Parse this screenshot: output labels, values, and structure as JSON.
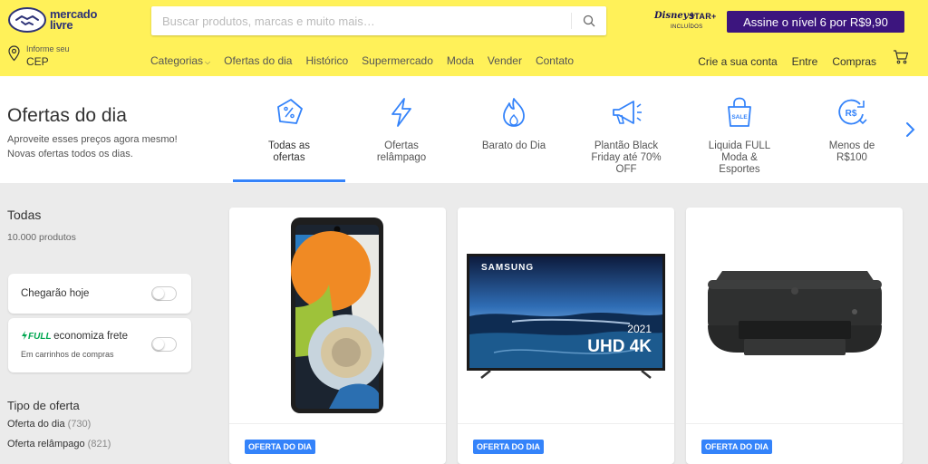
{
  "header": {
    "logo_line1": "mercado",
    "logo_line2": "livre",
    "search_placeholder": "Buscar produtos, marcas e muito mais…",
    "promo_partner_a": "Disney+",
    "promo_partner_b": "STAR+",
    "promo_partner_note": "INCLUÍDOS",
    "promo_button": "Assine o nível 6 por R$9,90",
    "location_label": "Informe seu",
    "location_value": "CEP",
    "nav": [
      "Categorias",
      "Ofertas do dia",
      "Histórico",
      "Supermercado",
      "Moda",
      "Vender",
      "Contato"
    ],
    "user_nav": [
      "Crie a sua conta",
      "Entre",
      "Compras"
    ]
  },
  "deals": {
    "title": "Ofertas do dia",
    "subtitle_1": "Aproveite esses preços agora mesmo!",
    "subtitle_2": "Novas ofertas todos os dias.",
    "categories": [
      {
        "icon": "percent-tag-icon",
        "line1": "Todas as",
        "line2": "ofertas",
        "line3": ""
      },
      {
        "icon": "lightning-icon",
        "line1": "Ofertas",
        "line2": "relâmpago",
        "line3": ""
      },
      {
        "icon": "flame-icon",
        "line1": "Barato do Dia",
        "line2": "",
        "line3": ""
      },
      {
        "icon": "megaphone-icon",
        "line1": "Plantão Black",
        "line2": "Friday até 70%",
        "line3": "OFF"
      },
      {
        "icon": "sale-bag-icon",
        "line1": "Liquida FULL",
        "line2": "Moda &",
        "line3": "Esportes"
      },
      {
        "icon": "money-down-icon",
        "line1": "Menos de",
        "line2": "R$100",
        "line3": ""
      }
    ],
    "active_index": 0
  },
  "sidebar": {
    "title": "Todas",
    "count": "10.000 produtos",
    "filter_1": "Chegarão hoje",
    "filter_2_badge": "FULL",
    "filter_2": "economiza frete",
    "filter_2_sub": "Em carrinhos de compras",
    "tipo_title": "Tipo de oferta",
    "tipo_items": [
      {
        "label": "Oferta do dia",
        "count": "(730)"
      },
      {
        "label": "Oferta relâmpago",
        "count": "(821)"
      }
    ]
  },
  "products": [
    {
      "image": "smartphone",
      "badge": "OFERTA DO DIA"
    },
    {
      "image": "samsung-tv",
      "brand": "SAMSUNG",
      "year": "2021",
      "label": "UHD 4K",
      "badge": "OFERTA DO DIA"
    },
    {
      "image": "printer",
      "badge": "OFERTA DO DIA"
    }
  ],
  "colors": {
    "header_bg": "#fff159",
    "accent_blue": "#3483fa",
    "promo_purple": "#3c157e",
    "full_green": "#00a650"
  }
}
